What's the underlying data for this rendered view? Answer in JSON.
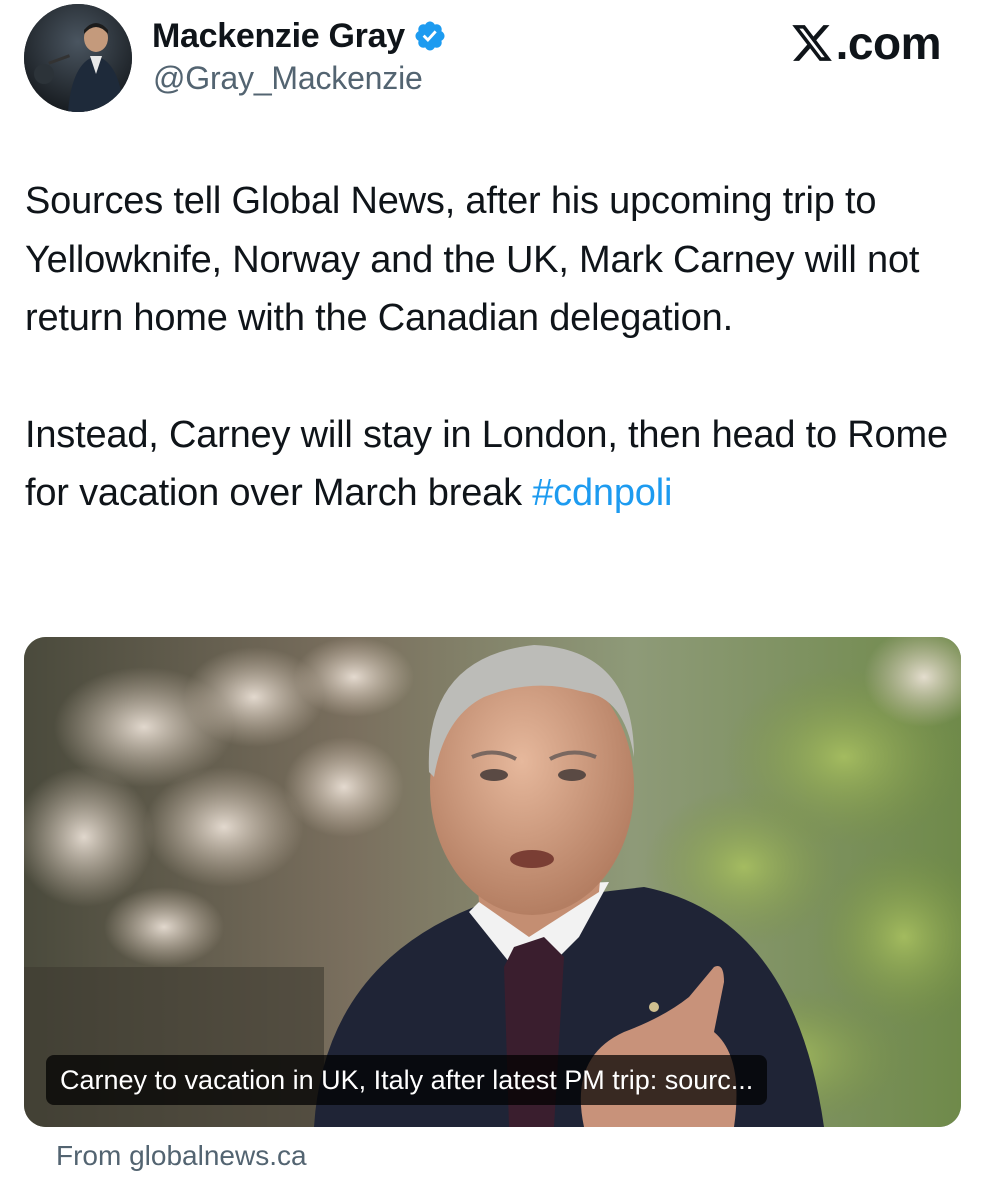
{
  "author": {
    "name": "Mackenzie Gray",
    "handle": "@Gray_Mackenzie",
    "verified": true,
    "verified_color": "#1d9bf0"
  },
  "brand": {
    "text": ".com",
    "icon": "x-logo-icon"
  },
  "tweet": {
    "paragraph_1": "Sources tell Global News, after his upcoming trip to Yellowknife, Norway and the UK, Mark Carney will not return home with the Canadian delegation.",
    "paragraph_2_text": "Instead, Carney will stay in London, then head to Rome for vacation over March break ",
    "hashtag": "#cdnpoli",
    "hashtag_color": "#1d9bf0"
  },
  "link_card": {
    "title": "Carney to vacation in UK, Italy after latest PM trip: sourc...",
    "source": "From globalnews.ca"
  },
  "colors": {
    "text_primary": "#0f1419",
    "text_secondary": "#536471"
  }
}
